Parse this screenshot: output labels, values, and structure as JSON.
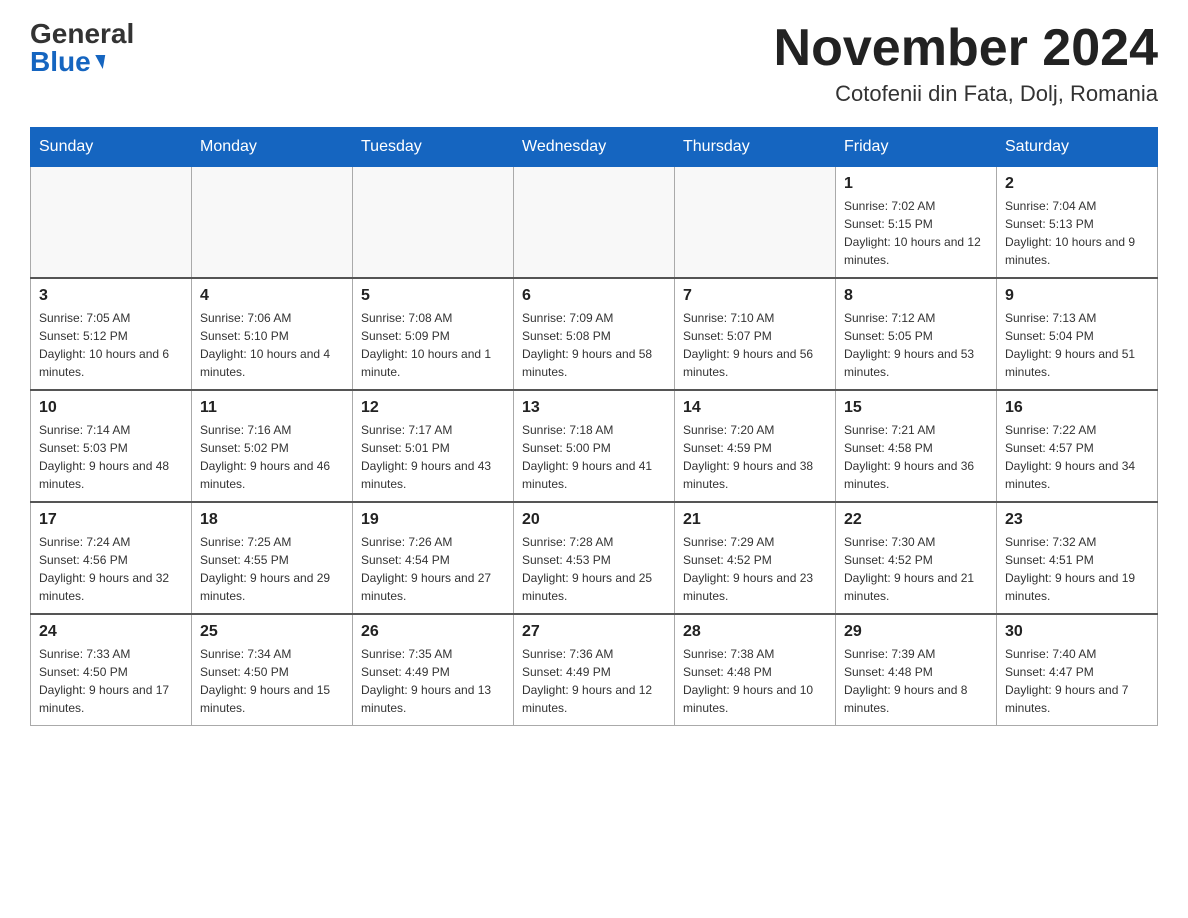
{
  "header": {
    "logo_general": "General",
    "logo_blue": "Blue",
    "title": "November 2024",
    "location": "Cotofenii din Fata, Dolj, Romania"
  },
  "weekdays": [
    "Sunday",
    "Monday",
    "Tuesday",
    "Wednesday",
    "Thursday",
    "Friday",
    "Saturday"
  ],
  "weeks": [
    [
      {
        "day": "",
        "info": ""
      },
      {
        "day": "",
        "info": ""
      },
      {
        "day": "",
        "info": ""
      },
      {
        "day": "",
        "info": ""
      },
      {
        "day": "",
        "info": ""
      },
      {
        "day": "1",
        "info": "Sunrise: 7:02 AM\nSunset: 5:15 PM\nDaylight: 10 hours and 12 minutes."
      },
      {
        "day": "2",
        "info": "Sunrise: 7:04 AM\nSunset: 5:13 PM\nDaylight: 10 hours and 9 minutes."
      }
    ],
    [
      {
        "day": "3",
        "info": "Sunrise: 7:05 AM\nSunset: 5:12 PM\nDaylight: 10 hours and 6 minutes."
      },
      {
        "day": "4",
        "info": "Sunrise: 7:06 AM\nSunset: 5:10 PM\nDaylight: 10 hours and 4 minutes."
      },
      {
        "day": "5",
        "info": "Sunrise: 7:08 AM\nSunset: 5:09 PM\nDaylight: 10 hours and 1 minute."
      },
      {
        "day": "6",
        "info": "Sunrise: 7:09 AM\nSunset: 5:08 PM\nDaylight: 9 hours and 58 minutes."
      },
      {
        "day": "7",
        "info": "Sunrise: 7:10 AM\nSunset: 5:07 PM\nDaylight: 9 hours and 56 minutes."
      },
      {
        "day": "8",
        "info": "Sunrise: 7:12 AM\nSunset: 5:05 PM\nDaylight: 9 hours and 53 minutes."
      },
      {
        "day": "9",
        "info": "Sunrise: 7:13 AM\nSunset: 5:04 PM\nDaylight: 9 hours and 51 minutes."
      }
    ],
    [
      {
        "day": "10",
        "info": "Sunrise: 7:14 AM\nSunset: 5:03 PM\nDaylight: 9 hours and 48 minutes."
      },
      {
        "day": "11",
        "info": "Sunrise: 7:16 AM\nSunset: 5:02 PM\nDaylight: 9 hours and 46 minutes."
      },
      {
        "day": "12",
        "info": "Sunrise: 7:17 AM\nSunset: 5:01 PM\nDaylight: 9 hours and 43 minutes."
      },
      {
        "day": "13",
        "info": "Sunrise: 7:18 AM\nSunset: 5:00 PM\nDaylight: 9 hours and 41 minutes."
      },
      {
        "day": "14",
        "info": "Sunrise: 7:20 AM\nSunset: 4:59 PM\nDaylight: 9 hours and 38 minutes."
      },
      {
        "day": "15",
        "info": "Sunrise: 7:21 AM\nSunset: 4:58 PM\nDaylight: 9 hours and 36 minutes."
      },
      {
        "day": "16",
        "info": "Sunrise: 7:22 AM\nSunset: 4:57 PM\nDaylight: 9 hours and 34 minutes."
      }
    ],
    [
      {
        "day": "17",
        "info": "Sunrise: 7:24 AM\nSunset: 4:56 PM\nDaylight: 9 hours and 32 minutes."
      },
      {
        "day": "18",
        "info": "Sunrise: 7:25 AM\nSunset: 4:55 PM\nDaylight: 9 hours and 29 minutes."
      },
      {
        "day": "19",
        "info": "Sunrise: 7:26 AM\nSunset: 4:54 PM\nDaylight: 9 hours and 27 minutes."
      },
      {
        "day": "20",
        "info": "Sunrise: 7:28 AM\nSunset: 4:53 PM\nDaylight: 9 hours and 25 minutes."
      },
      {
        "day": "21",
        "info": "Sunrise: 7:29 AM\nSunset: 4:52 PM\nDaylight: 9 hours and 23 minutes."
      },
      {
        "day": "22",
        "info": "Sunrise: 7:30 AM\nSunset: 4:52 PM\nDaylight: 9 hours and 21 minutes."
      },
      {
        "day": "23",
        "info": "Sunrise: 7:32 AM\nSunset: 4:51 PM\nDaylight: 9 hours and 19 minutes."
      }
    ],
    [
      {
        "day": "24",
        "info": "Sunrise: 7:33 AM\nSunset: 4:50 PM\nDaylight: 9 hours and 17 minutes."
      },
      {
        "day": "25",
        "info": "Sunrise: 7:34 AM\nSunset: 4:50 PM\nDaylight: 9 hours and 15 minutes."
      },
      {
        "day": "26",
        "info": "Sunrise: 7:35 AM\nSunset: 4:49 PM\nDaylight: 9 hours and 13 minutes."
      },
      {
        "day": "27",
        "info": "Sunrise: 7:36 AM\nSunset: 4:49 PM\nDaylight: 9 hours and 12 minutes."
      },
      {
        "day": "28",
        "info": "Sunrise: 7:38 AM\nSunset: 4:48 PM\nDaylight: 9 hours and 10 minutes."
      },
      {
        "day": "29",
        "info": "Sunrise: 7:39 AM\nSunset: 4:48 PM\nDaylight: 9 hours and 8 minutes."
      },
      {
        "day": "30",
        "info": "Sunrise: 7:40 AM\nSunset: 4:47 PM\nDaylight: 9 hours and 7 minutes."
      }
    ]
  ]
}
